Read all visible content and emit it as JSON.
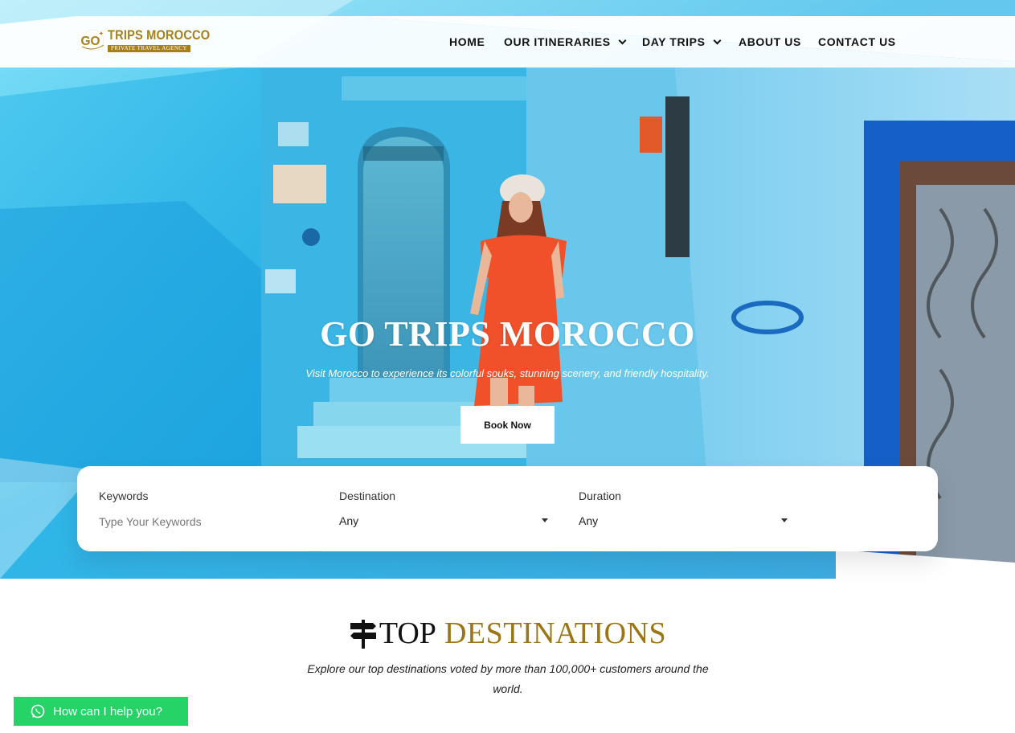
{
  "brand": {
    "logo_mark": "GO",
    "name": "TRIPS MOROCCO",
    "tagline": "PRIVATE TRAVEL AGENCY",
    "gold": "#a8801a"
  },
  "nav": {
    "items": [
      {
        "label": "HOME",
        "has_dropdown": false
      },
      {
        "label": "OUR ITINERARIES",
        "has_dropdown": true
      },
      {
        "label": "DAY TRIPS",
        "has_dropdown": true
      },
      {
        "label": "ABOUT US",
        "has_dropdown": false
      },
      {
        "label": "CONTACT US",
        "has_dropdown": false
      }
    ]
  },
  "hero": {
    "title": "GO TRIPS MOROCCO",
    "subtitle": "Visit Morocco to experience its colorful souks, stunning scenery, and friendly hospitality.",
    "cta_label": "Book Now"
  },
  "search": {
    "keywords": {
      "label": "Keywords",
      "placeholder": "Type Your Keywords"
    },
    "destination": {
      "label": "Destination",
      "value": "Any"
    },
    "duration": {
      "label": "Duration",
      "value": "Any"
    }
  },
  "destinations": {
    "title_part1": "TOP",
    "title_part2": "DESTINATIONS",
    "description": "Explore our top destinations voted by more than 100,000+ customers around the world."
  },
  "whatsapp": {
    "label": "How can I help you?",
    "color": "#25d366"
  },
  "colors": {
    "hero_blue": "#33b8e6",
    "accent_gold": "#9c7616",
    "dress_orange": "#f0512a"
  }
}
